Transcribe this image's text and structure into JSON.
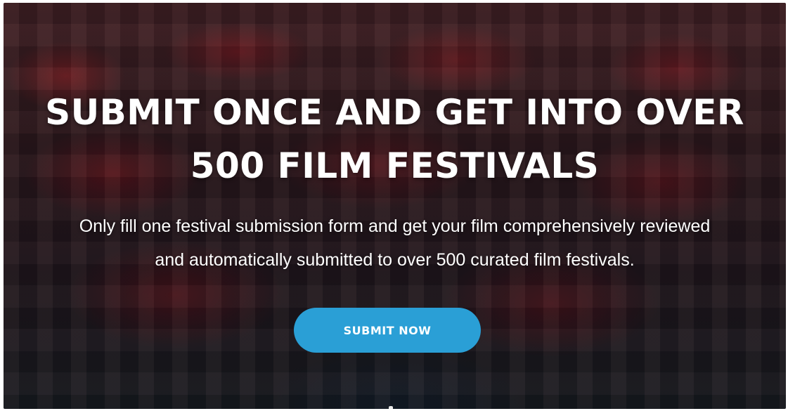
{
  "hero": {
    "headline_line1": "SUBMIT ONCE AND GET INTO OVER",
    "headline_line2": "500 FILM FESTIVALS",
    "subtext_line1": "Only fill one festival submission form and get your film comprehensively reviewed",
    "subtext_line2": "and automatically submitted to over 500 curated film festivals.",
    "cta_label": "SUBMIT NOW"
  },
  "colors": {
    "cta_background": "#2a9fd6",
    "text": "#ffffff"
  }
}
